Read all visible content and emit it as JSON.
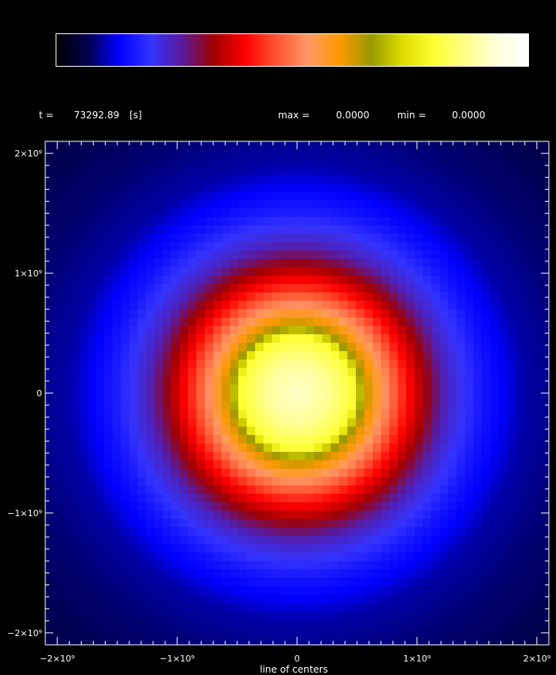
{
  "header": {
    "time_label": "t =",
    "time_value": "73292.89",
    "time_unit": "[s]",
    "max_label": "max =",
    "max_value": "0.0000",
    "min_label": "min =",
    "min_value": "0.0000"
  },
  "colorbar": {
    "stops": [
      "#000000",
      "#000050",
      "#0000ff",
      "#3333ff",
      "#5a1a9a",
      "#a00000",
      "#ff0000",
      "#ff5533",
      "#ff9966",
      "#ff9900",
      "#999900",
      "#dddd00",
      "#ffff33",
      "#ffff88",
      "#ffffdd",
      "#ffffff"
    ]
  },
  "chart_data": {
    "type": "heatmap",
    "xlabel": "line of centers",
    "ylabel": "",
    "xlim": [
      -2100000000.0,
      2100000000.0
    ],
    "ylim": [
      -2100000000.0,
      2100000000.0
    ],
    "x_ticks": [
      {
        "value": -2000000000.0,
        "label": "−2×10⁹"
      },
      {
        "value": -1000000000.0,
        "label": "−1×10⁹"
      },
      {
        "value": 0,
        "label": "0"
      },
      {
        "value": 1000000000.0,
        "label": "1×10⁹"
      },
      {
        "value": 2000000000.0,
        "label": "2×10⁹"
      }
    ],
    "y_ticks": [
      {
        "value": 2000000000.0,
        "label": "2×10⁹"
      },
      {
        "value": 1000000000.0,
        "label": "1×10⁹"
      },
      {
        "value": 0,
        "label": "0"
      },
      {
        "value": -1000000000.0,
        "label": "−1×10⁹"
      },
      {
        "value": -2000000000.0,
        "label": "−2×10⁹"
      }
    ],
    "grid": false,
    "pixel_cells": 60,
    "field": {
      "center": [
        0,
        0
      ],
      "radial_profile": [
        {
          "r": 0,
          "level": 0.92
        },
        {
          "r": 250000000.0,
          "level": 0.88
        },
        {
          "r": 470000000.0,
          "level": 0.8
        },
        {
          "r": 550000000.0,
          "level": 0.66
        },
        {
          "r": 630000000.0,
          "level": 0.6
        },
        {
          "r": 740000000.0,
          "level": 0.52
        },
        {
          "r": 900000000.0,
          "level": 0.42
        },
        {
          "r": 1050000000.0,
          "level": 0.34
        },
        {
          "r": 1250000000.0,
          "level": 0.24
        },
        {
          "r": 1400000000.0,
          "level": 0.2
        },
        {
          "r": 1550000000.0,
          "level": 0.16
        },
        {
          "r": 1900000000.0,
          "level": 0.1
        },
        {
          "r": 2300000000.0,
          "level": 0.08
        },
        {
          "r": 3000000000.0,
          "level": 0.06
        }
      ]
    }
  }
}
